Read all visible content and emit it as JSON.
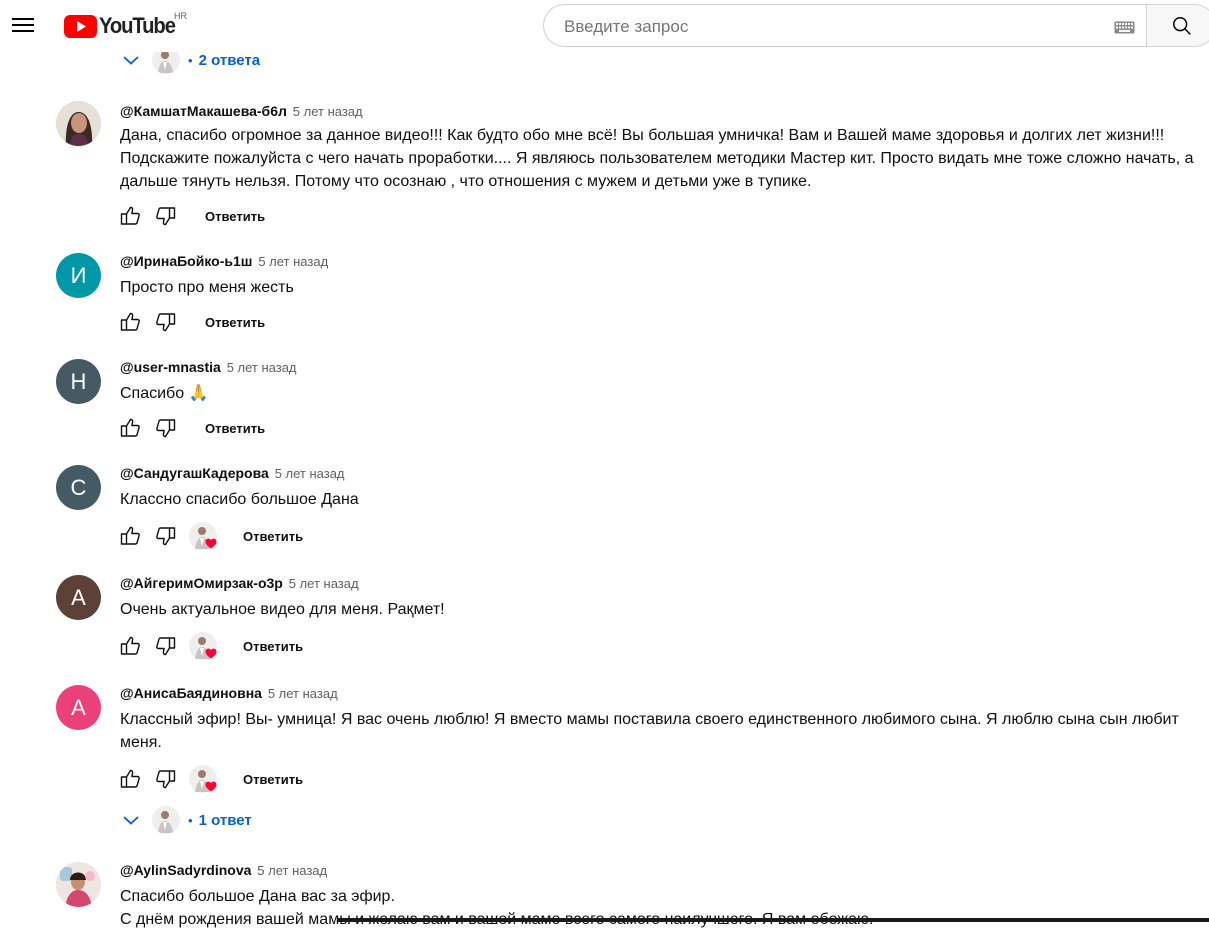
{
  "header": {
    "logo_text": "YouTube",
    "country_code": "HR",
    "search_placeholder": "Введите запрос"
  },
  "reply_toggles": [
    {
      "label": "2 ответа"
    },
    {
      "label": "1 ответ"
    }
  ],
  "comments": [
    {
      "author": "@КамшатМакашева-б6л",
      "time": "5 лет назад",
      "text": "Дана, спасибо огромное за данное видео!!! Как будто обо мне всё! Вы большая умничка! Вам и Вашей маме здоровья и долгих лет жизни!!! Подскажите пожалуйста  с чего начать проработки.... Я являюсь пользователем методики Мастер кит. Просто видать мне тоже сложно начать, а дальше тянуть нельзя. Потому что осознаю , что отношения с мужем и детьми уже в тупике.",
      "avatar_letter": "",
      "avatar_color": "#d9d2c5",
      "reply_label": "Ответить"
    },
    {
      "author": "@ИринаБойко-ь1ш",
      "time": "5 лет назад",
      "text": "Просто про меня жесть",
      "avatar_letter": "И",
      "avatar_color": "#0097a7",
      "reply_label": "Ответить"
    },
    {
      "author": "@user-mnastia",
      "time": "5 лет назад",
      "text": "Спасибо 🙏",
      "avatar_letter": "Н",
      "avatar_color": "#455a64",
      "reply_label": "Ответить"
    },
    {
      "author": "@СандугашКадерова",
      "time": "5 лет назад",
      "text": "Классно спасибо большое Дана",
      "avatar_letter": "С",
      "avatar_color": "#455a64",
      "reply_label": "Ответить"
    },
    {
      "author": "@АйгеримОмирзак-о3р",
      "time": "5 лет назад",
      "text": "Очень актуальное  видео для меня. Рақмет!",
      "avatar_letter": "А",
      "avatar_color": "#5d4037",
      "reply_label": "Ответить"
    },
    {
      "author": "@АнисаБаядиновна",
      "time": "5 лет назад",
      "text": "Классный эфир! Вы- умница! Я вас очень люблю! Я вместо мамы поставила своего единственного любимого сына. Я люблю сына сын любит меня.",
      "avatar_letter": "А",
      "avatar_color": "#ec407a",
      "reply_label": "Ответить"
    },
    {
      "author": "@AylinSadyrdinova",
      "time": "5 лет назад",
      "text": "Спасибо большое Дана вас за эфир.",
      "text2": "С днём рождения вашей мамы и желаю вам и вашей маме всего самого наилучшего. Я вам обожаю.",
      "avatar_letter": "",
      "avatar_color": "#e8dcd8"
    }
  ],
  "colors": {
    "link_blue": "#065fd4",
    "heart_red": "#ff0033",
    "brand_red": "#ff0000"
  }
}
